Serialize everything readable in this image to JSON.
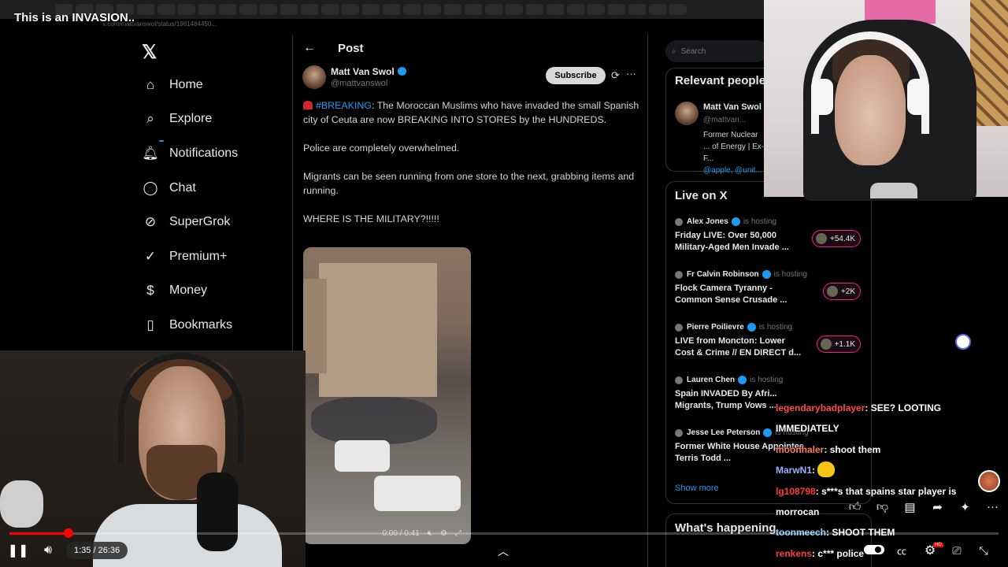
{
  "video": {
    "title": "This is an INVASION..",
    "url": "x.com/mattvanswol/status/1981484450...",
    "current_time": "1:35",
    "duration": "26:36",
    "time_display": "1:35 / 26:36",
    "progress": 0.06
  },
  "nav": {
    "items": [
      {
        "label": "Home",
        "icon": "home-icon"
      },
      {
        "label": "Explore",
        "icon": "search-icon"
      },
      {
        "label": "Notifications",
        "icon": "bell-icon"
      },
      {
        "label": "Chat",
        "icon": "chat-icon"
      },
      {
        "label": "SuperGrok",
        "icon": "grok-icon"
      },
      {
        "label": "Premium+",
        "icon": "check-badge-icon"
      },
      {
        "label": "Money",
        "icon": "dollar-icon"
      },
      {
        "label": "Bookmarks",
        "icon": "bookmark-icon"
      }
    ]
  },
  "post": {
    "header": "Post",
    "author_name": "Matt Van Swol",
    "author_handle": "@mattvanswol",
    "subscribe_label": "Subscribe",
    "hashtag": "#BREAKING",
    "line1_rest": ": The Moroccan Muslims who have invaded the small Spanish city of Ceuta are now BREAKING INTO STORES by the HUNDREDS.",
    "line2": "Police are completely overwhelmed.",
    "line3": "Migrants can be seen running from one store to the next, grabbing items and running.",
    "line4": "WHERE IS THE MILITARY?!!!!!",
    "video_time": "0:00 / 0:41"
  },
  "sidebar": {
    "search_placeholder": "Search",
    "relevant_title": "Relevant people",
    "rel_name": "Matt Van Swol",
    "rel_handle": "@mattvan...",
    "rel_bio": "Former Nuclear ... of Energy | Ex-F...",
    "rel_links": "@apple, @unit...",
    "live_title": "Live on X",
    "live": [
      {
        "host": "Alex Jones",
        "status": "is hosting",
        "title": "Friday LIVE: Over 50,000 Military-Aged Men Invade ...",
        "count": "+54.4K"
      },
      {
        "host": "Fr Calvin Robinson",
        "status": "is hosting",
        "title": "Flock Camera Tyranny - Common Sense Crusade ...",
        "count": "+2K"
      },
      {
        "host": "Pierre Poilievre",
        "status": "is hosting",
        "title": "LIVE from Moncton: Lower Cost & Crime // EN DIRECT d...",
        "count": "+1.1K"
      },
      {
        "host": "Lauren Chen",
        "status": "is hosting",
        "title": "Spain INVADED By Afri... Migrants, Trump Vows ...",
        "count": ""
      },
      {
        "host": "Jesse Lee Peterson",
        "status": "is hosting",
        "title": "Former White House Appointee Terris Todd ...",
        "count": ""
      }
    ],
    "show_more": "Show more",
    "happening": "What's happening"
  },
  "chat": [
    {
      "user": "legendarybadplayer",
      "color": "#ff4b4b",
      "text": "SEE? LOOTING IMMEDIATELY"
    },
    {
      "user": "moonhaler",
      "color": "#ff7a59",
      "text": "shoot them"
    },
    {
      "user": "MarwN1",
      "color": "#9ab0ff",
      "text": ""
    },
    {
      "user": "lg108798",
      "color": "#ff3b3b",
      "text": "s***s that spains star player is morrocan"
    },
    {
      "user": "toonmeech",
      "color": "#8fd0ff",
      "text": "SHOOT THEM"
    },
    {
      "user": "renkens",
      "color": "#ff3b3b",
      "text": "c*** police"
    }
  ],
  "player": {
    "hd": "HD"
  }
}
